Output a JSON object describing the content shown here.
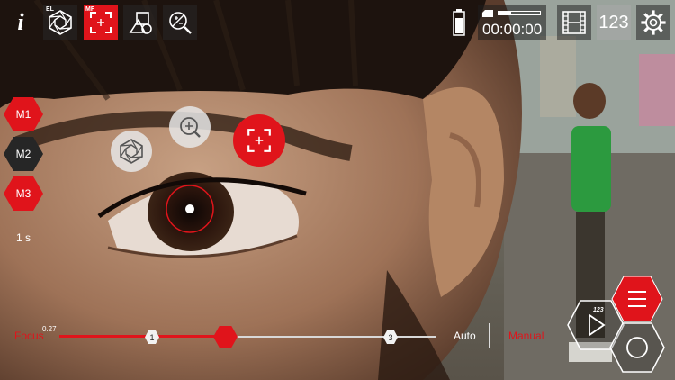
{
  "toolbar": {
    "info_label": "i",
    "el_tag": "EL",
    "mf_tag": "MF",
    "timecode": "00:00:00",
    "counter_label": "123",
    "accent_color": "#e0141b"
  },
  "memory": {
    "m1": "M1",
    "m2": "M2",
    "m3": "M3",
    "duration": "1 s"
  },
  "focus": {
    "label": "Focus",
    "value": "0.27",
    "marker_1": "1",
    "marker_3": "3",
    "auto_label": "Auto",
    "manual_label": "Manual",
    "position_fraction": 0.27
  },
  "record": {
    "badge": "123"
  },
  "icons": {
    "info": "info-icon",
    "exposure_lock": "aperture-icon",
    "manual_focus": "focus-frame-icon",
    "white_balance": "shapes-icon",
    "exposure_comp": "exposure-icon",
    "battery": "battery-icon",
    "storage": "storage-icon",
    "film": "film-icon",
    "settings": "gear-icon",
    "menu": "menu-icon",
    "play": "play-icon",
    "shutter": "shutter-icon"
  }
}
